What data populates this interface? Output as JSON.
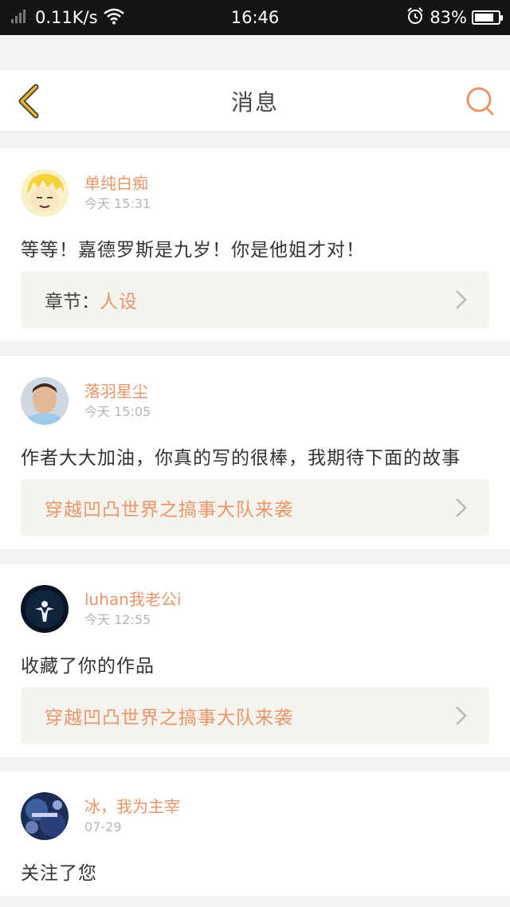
{
  "status_bar": {
    "network_speed": "0.11K/s",
    "time": "16:46",
    "battery_percent": "83%",
    "battery_level": 0.83
  },
  "header": {
    "title": "消息"
  },
  "colors": {
    "accent": "#e8956a",
    "back_icon": "#f0b429",
    "background": "#f3f3f1"
  },
  "messages": [
    {
      "username": "单纯白痴",
      "time": "今天 15:31",
      "content": "等等！嘉德罗斯是九岁！你是他姐才对！",
      "link_prefix": "章节：",
      "link_text": "人设",
      "avatar": "anime-avatar"
    },
    {
      "username": "落羽星尘",
      "time": "今天 15:05",
      "content": "作者大大加油，你真的写的很棒，我期待下面的故事",
      "link_prefix": "",
      "link_text": "穿越凹凸世界之搞事大队来袭",
      "avatar": "photo-avatar"
    },
    {
      "username": "luhan我老公i",
      "time": "今天 12:55",
      "content": "收藏了你的作品",
      "link_prefix": "",
      "link_text": "穿越凹凸世界之搞事大队来袭",
      "avatar": "stage-avatar"
    },
    {
      "username": "冰，我为主宰",
      "time": "07-29",
      "content": "关注了您",
      "avatar": "galaxy-avatar"
    }
  ]
}
